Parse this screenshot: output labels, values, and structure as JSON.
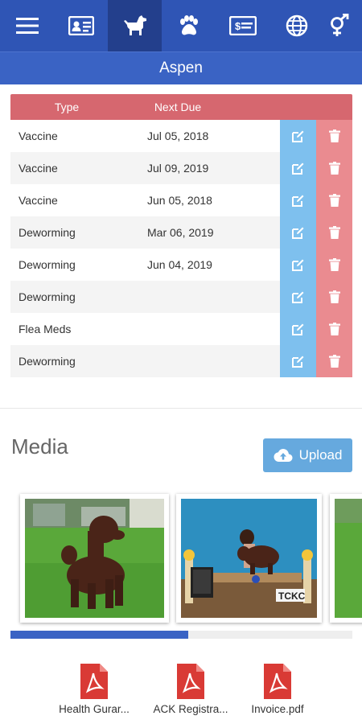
{
  "nav": {
    "items": [
      {
        "icon": "menu-icon"
      },
      {
        "icon": "id-card-icon"
      },
      {
        "icon": "dog-icon",
        "active": true
      },
      {
        "icon": "paw-icon"
      },
      {
        "icon": "payment-card-icon"
      },
      {
        "icon": "globe-icon"
      },
      {
        "icon": "gender-icon"
      }
    ]
  },
  "title": "Aspen",
  "table": {
    "headers": {
      "type": "Type",
      "due": "Next Due"
    },
    "rows": [
      {
        "type": "Vaccine",
        "due": "Jul 05, 2018"
      },
      {
        "type": "Vaccine",
        "due": "Jul 09, 2019"
      },
      {
        "type": "Vaccine",
        "due": "Jun 05, 2018"
      },
      {
        "type": "Deworming",
        "due": "Mar 06, 2019"
      },
      {
        "type": "Deworming",
        "due": "Jun 04, 2019"
      },
      {
        "type": "Deworming",
        "due": ""
      },
      {
        "type": "Flea Meds",
        "due": ""
      },
      {
        "type": "Deworming",
        "due": ""
      }
    ]
  },
  "media": {
    "title": "Media",
    "upload_label": "Upload",
    "photos": [
      {
        "desc": "poodle-on-grass"
      },
      {
        "desc": "dog-show-photo"
      },
      {
        "desc": "partial-photo"
      }
    ],
    "scroll_fraction": 0.52
  },
  "documents": [
    {
      "name": "Health Gurar..."
    },
    {
      "name": "ACK Registra..."
    },
    {
      "name": "Invoice.pdf"
    }
  ],
  "colors": {
    "nav_bg": "#2f55b5",
    "nav_active": "#233f8c",
    "title_bg": "#3a63c4",
    "table_header": "#d6676f",
    "edit": "#7ec0ee",
    "delete": "#ea8b90",
    "upload": "#66a9de",
    "pdf": "#d93a35"
  }
}
